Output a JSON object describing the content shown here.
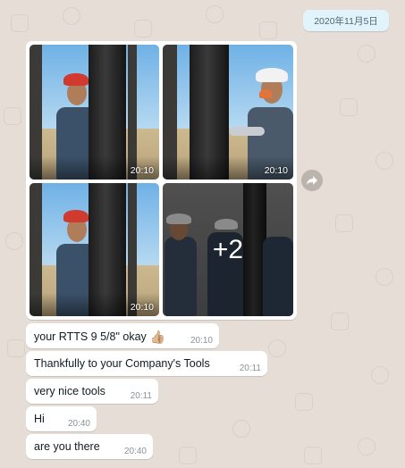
{
  "date_divider": "2020年11月5日",
  "album": {
    "photos": [
      {
        "time": "20:10",
        "icon": "photo"
      },
      {
        "time": "20:10",
        "icon": "photo"
      },
      {
        "time": "20:10",
        "icon": "photo"
      },
      {
        "more_count": "+2",
        "icon": "photo"
      }
    ]
  },
  "forward_icon": "forward-icon",
  "messages": [
    {
      "text": "your RTTS 9 5/8\" okay",
      "emoji": "👍🏼",
      "time": "20:10"
    },
    {
      "text": "Thankfully  to your Company's Tools",
      "time": "20:11"
    },
    {
      "text": "very nice tools",
      "time": "20:11"
    },
    {
      "text": "Hi",
      "time": "20:40"
    },
    {
      "text": "are you there",
      "time": "20:40"
    }
  ],
  "colors": {
    "chat_background": "#e6ded6",
    "incoming_bubble": "#ffffff",
    "date_pill": "#e1f3fb",
    "meta_text": "#8a9297"
  }
}
